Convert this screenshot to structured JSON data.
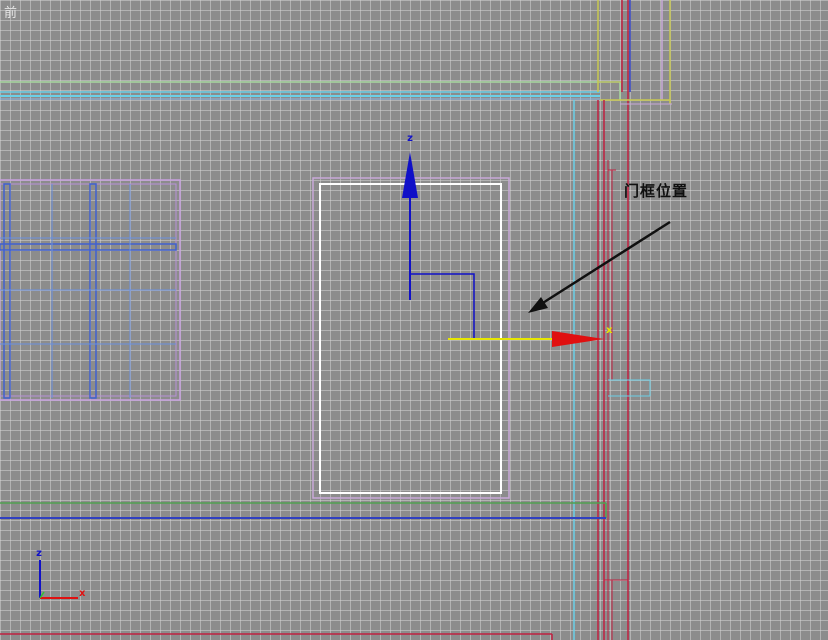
{
  "viewport": {
    "label": "前",
    "annotation": "门框位置"
  },
  "gizmo": {
    "z_label": "z",
    "x_label": "x"
  },
  "view_axes": {
    "z_label": "z",
    "x_label": "x"
  },
  "colors": {
    "grid_bg": "#8c8c8c",
    "z_axis": "#1010c8",
    "x_axis": "#e01010",
    "selected_axis": "#e6e600",
    "door": "#ffffff",
    "door_outer": "#c8a8d8",
    "window": "#c8a0e0",
    "wall_cyan": "#6ad0e8",
    "wall_red": "#c02040",
    "wall_green": "#50a050",
    "wall_yellow": "#c8c850"
  }
}
